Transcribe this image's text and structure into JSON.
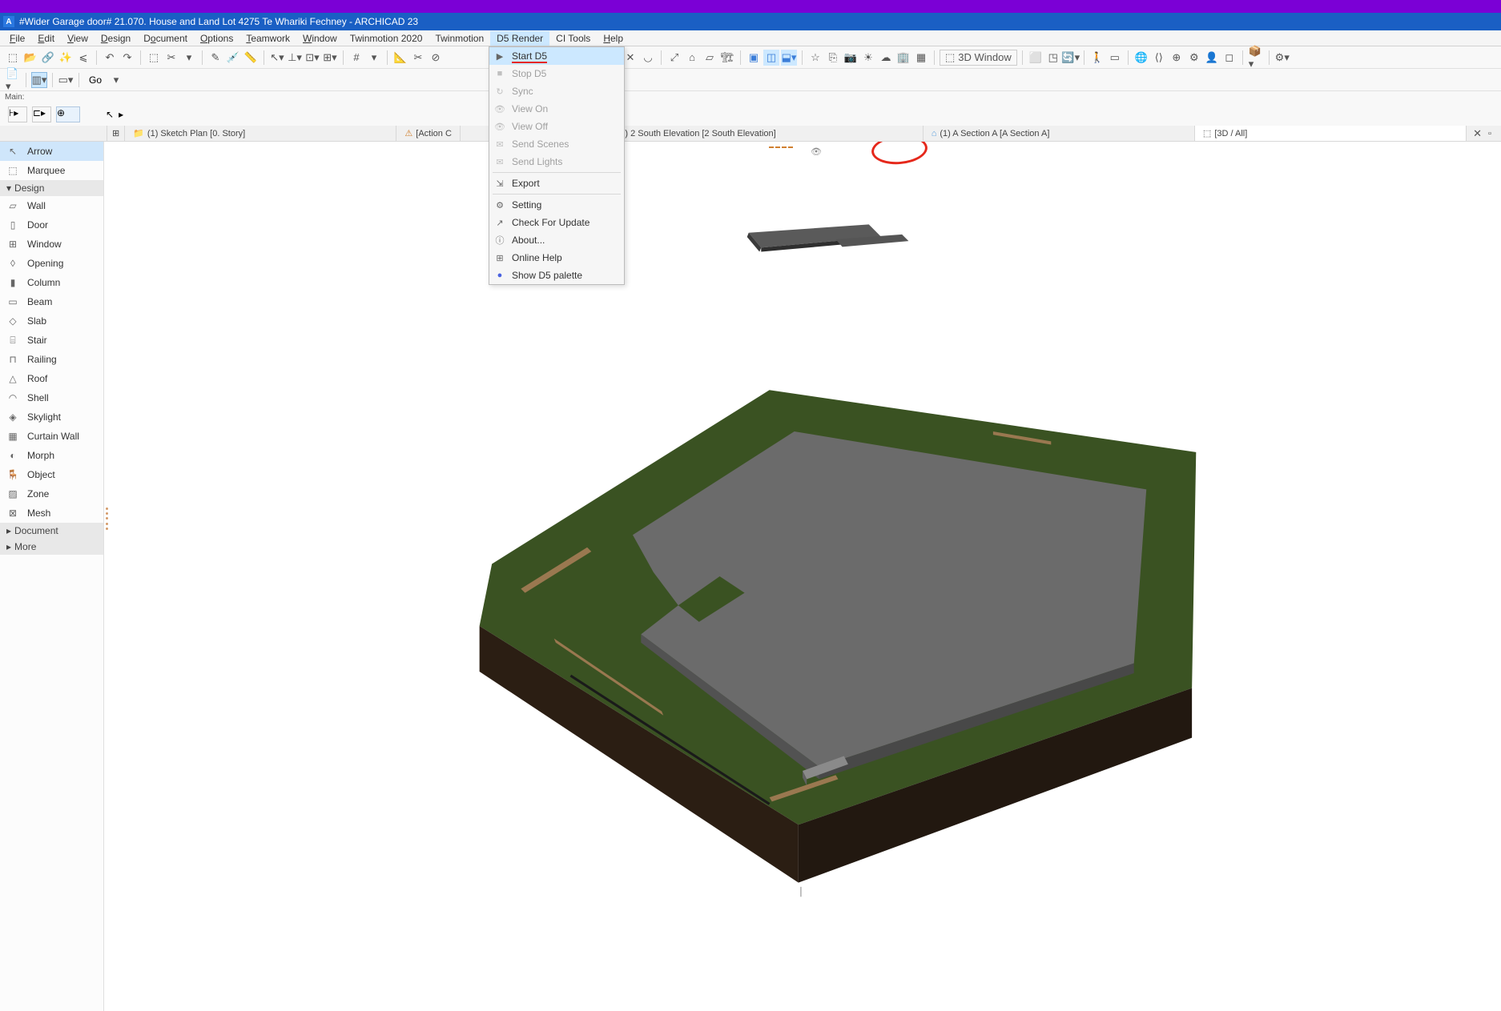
{
  "titlebar": {
    "app_letter": "A",
    "title": "#Wider Garage door# 21.070. House and Land Lot 4275 Te Whariki Fechney - ARCHICAD 23"
  },
  "menubar": {
    "items": [
      "File",
      "Edit",
      "View",
      "Design",
      "Document",
      "Options",
      "Teamwork",
      "Window",
      "Twinmotion 2020",
      "Twinmotion",
      "D5 Render",
      "CI Tools",
      "Help"
    ]
  },
  "toolbar": {
    "window3d_label": "3D Window",
    "go_label": "Go"
  },
  "main_label": "Main:",
  "dropdown": {
    "items": [
      {
        "label": "Start D5",
        "disabled": false,
        "highlighted": true,
        "icon": "▶"
      },
      {
        "label": "Stop D5",
        "disabled": true,
        "icon": "■"
      },
      {
        "label": "Sync",
        "disabled": true,
        "icon": "↻"
      },
      {
        "label": "View On",
        "disabled": true,
        "icon": "👁"
      },
      {
        "label": "View Off",
        "disabled": true,
        "icon": "👁"
      },
      {
        "label": "Send Scenes",
        "disabled": true,
        "icon": "✉"
      },
      {
        "label": "Send Lights",
        "disabled": true,
        "icon": "✉"
      },
      {
        "sep": true
      },
      {
        "label": "Export",
        "disabled": false,
        "icon": "⇲"
      },
      {
        "sep": true
      },
      {
        "label": "Setting",
        "disabled": false,
        "icon": "⚙"
      },
      {
        "label": "Check For Update",
        "disabled": false,
        "icon": "↗"
      },
      {
        "label": "About...",
        "disabled": false,
        "icon": "ⓘ"
      },
      {
        "label": "Online Help",
        "disabled": false,
        "icon": "⊞"
      },
      {
        "label": "Show D5 palette",
        "disabled": false,
        "icon": "●"
      }
    ]
  },
  "left_panel": {
    "selection_tools": [
      {
        "label": "Arrow",
        "selected": true
      },
      {
        "label": "Marquee",
        "selected": false
      }
    ],
    "design_header": "Design",
    "design_tools": [
      "Wall",
      "Door",
      "Window",
      "Opening",
      "Column",
      "Beam",
      "Slab",
      "Stair",
      "Railing",
      "Roof",
      "Shell",
      "Skylight",
      "Curtain Wall",
      "Morph",
      "Object",
      "Zone",
      "Mesh"
    ],
    "document_header": "Document",
    "more_header": "More"
  },
  "tabs": {
    "items": [
      {
        "label": "(1) Sketch Plan [0. Story]",
        "icon": "folder"
      },
      {
        "label": "[Action C",
        "icon": "warn"
      },
      {
        "label": "(1) 2 South Elevation [2 South Elevation]",
        "icon": "elev"
      },
      {
        "label": "(1) A Section A [A Section A]",
        "icon": "sect"
      },
      {
        "label": "[3D / All]",
        "icon": "cube",
        "active": true
      }
    ]
  }
}
